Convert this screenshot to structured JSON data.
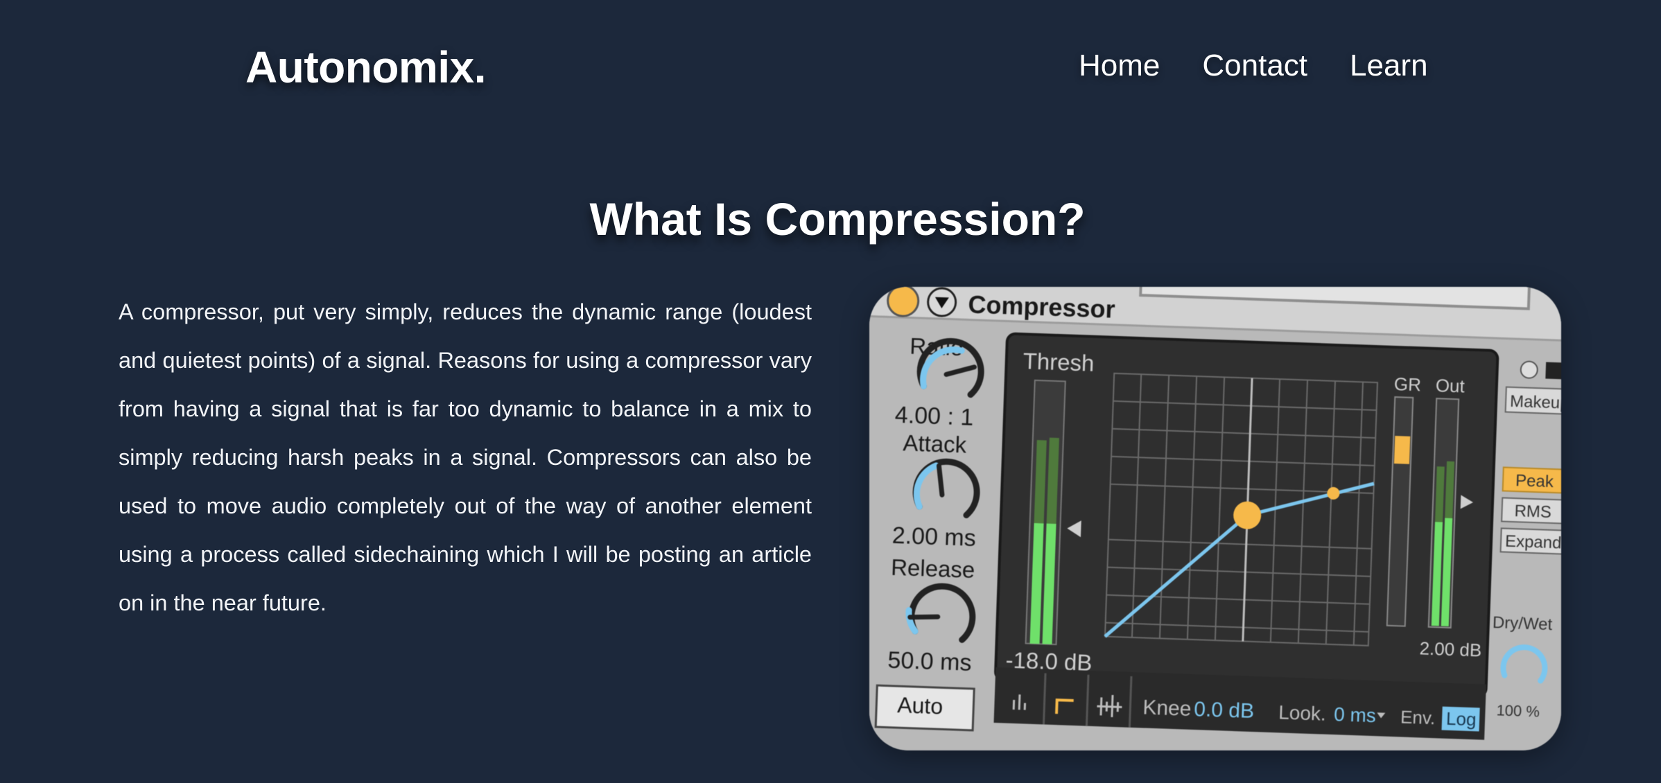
{
  "header": {
    "logo": "Autonomix.",
    "nav": [
      "Home",
      "Contact",
      "Learn"
    ]
  },
  "main": {
    "heading": "What Is Compression?",
    "paragraph": "A compressor, put very simply, reduces the dynamic range (loudest and quietest points) of a signal. Reasons for using a compressor vary from having a signal that is far too dynamic to balance in a mix to simply reducing harsh peaks in a signal. Compressors can also be used to move audio completely out of the way of another element using a process called sidechaining which I will be posting an article on in the near future."
  },
  "plugin": {
    "title": "Compressor",
    "ratio_label": "Ratio",
    "ratio_value": "4.00 : 1",
    "attack_label": "Attack",
    "attack_value": "2.00 ms",
    "release_label": "Release",
    "release_value": "50.0 ms",
    "auto_label": "Auto",
    "thresh_label": "Thresh",
    "thresh_value": "-18.0 dB",
    "gr_label": "GR",
    "out_label": "Out",
    "out_value": "2.00 dB",
    "makeup_label": "Makeup",
    "mode_buttons": [
      "Peak",
      "RMS",
      "Expand"
    ],
    "drywet_label": "Dry/Wet",
    "drywet_value": "100 %",
    "knee_label": "Knee",
    "knee_value": "0.0 dB",
    "look_label": "Look.",
    "look_value": "0 ms",
    "env_label": "Env.",
    "env_value": "Log",
    "accent_color": "#f6b94a",
    "meter_color": "#6fe06a",
    "knob_arc_color": "#7cc6ee"
  }
}
